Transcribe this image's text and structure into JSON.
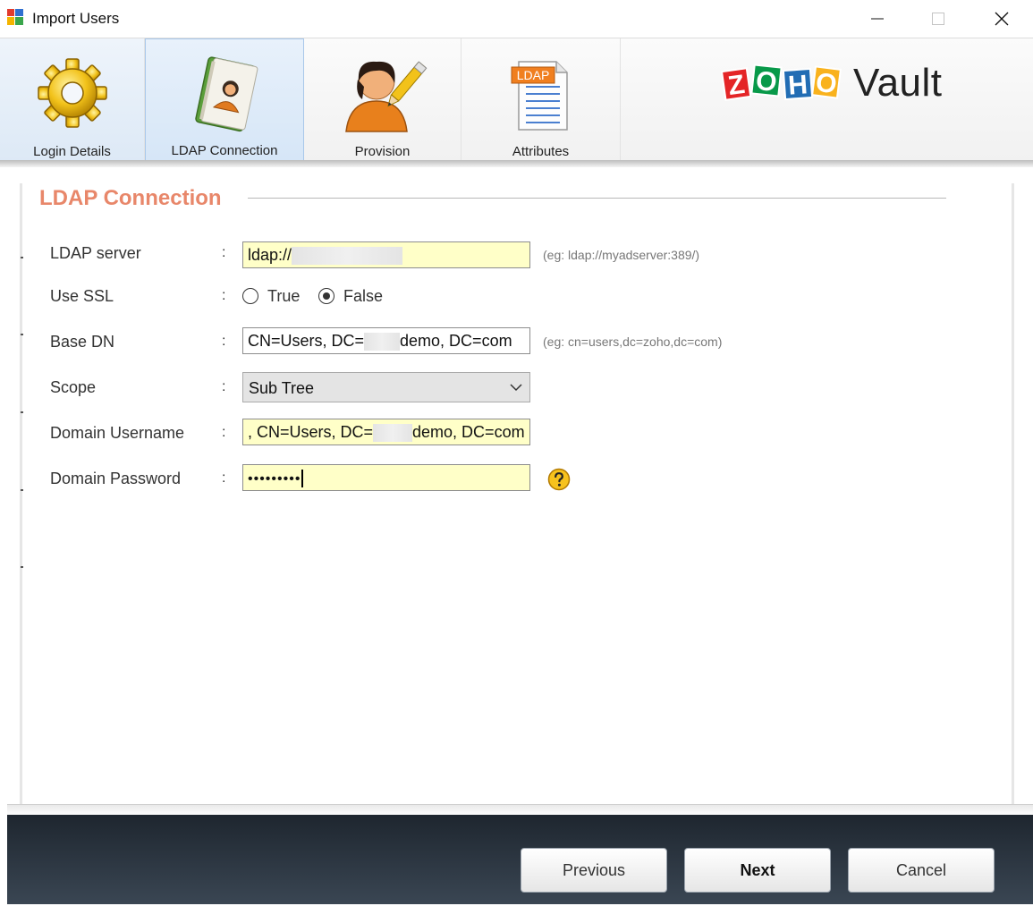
{
  "window": {
    "title": "Import Users"
  },
  "tabs": [
    {
      "label": "Login Details"
    },
    {
      "label": "LDAP Connection"
    },
    {
      "label": "Provision"
    },
    {
      "label": "Attributes"
    }
  ],
  "tab_icons": {
    "attributes_badge": "LDAP"
  },
  "logo": {
    "letters": [
      "Z",
      "O",
      "H",
      "O"
    ],
    "letter_colors": [
      "#e42527",
      "#089949",
      "#226db4",
      "#f9b21d"
    ],
    "product": "Vault"
  },
  "section": {
    "title": "LDAP Connection"
  },
  "form": {
    "ldap_server": {
      "label": "LDAP server",
      "value": "ldap://",
      "hint": "(eg: ldap://myadserver:389/)"
    },
    "use_ssl": {
      "label": "Use SSL",
      "options": [
        "True",
        "False"
      ],
      "selected": "False"
    },
    "base_dn": {
      "label": "Base DN",
      "value_prefix": "CN=Users, DC=",
      "value_suffix": "demo, DC=com",
      "hint": "(eg: cn=users,dc=zoho,dc=com)"
    },
    "scope": {
      "label": "Scope",
      "selected": "Sub Tree"
    },
    "domain_username": {
      "label": "Domain Username",
      "value_prefix": ", CN=Users, DC=",
      "value_suffix": "demo, DC=com"
    },
    "domain_password": {
      "label": "Domain Password",
      "masked_value": "•••••••••"
    },
    "colon": ":"
  },
  "footer": {
    "previous_label": "Previous",
    "next_label": "Next",
    "cancel_label": "Cancel"
  },
  "colors": {
    "section_title": "#e8876a",
    "input_highlight": "#ffffc8",
    "active_tab": "#d6e6f7",
    "footer_bg": "#2a333d"
  }
}
